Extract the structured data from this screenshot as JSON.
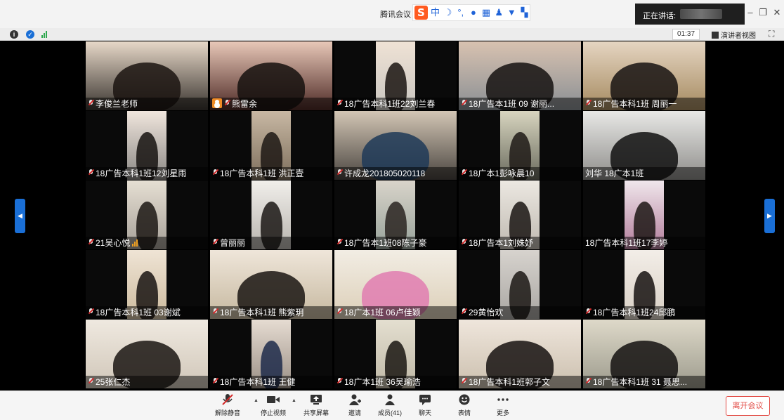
{
  "window": {
    "title": "腾讯会议",
    "speaking_label": "正在讲话:",
    "ime_logo": "S",
    "ime_mode": "中",
    "minimize_glyph": "–",
    "restore_glyph": "❐",
    "close_glyph": "✕"
  },
  "statusbar": {
    "timer": "01:37",
    "speaker_view_label": "演讲者视图",
    "fullscreen_glyph": "⛶"
  },
  "participants": [
    {
      "name": "李俊兰老师",
      "muted": true
    },
    {
      "name": "熊雷余",
      "muted": true,
      "host": true
    },
    {
      "name": "18广告本科1班22刘兰春",
      "muted": true
    },
    {
      "name": "18广告本1班 09 谢丽...",
      "muted": true
    },
    {
      "name": "18广告本科1班 周丽一",
      "muted": true
    },
    {
      "name": "18广告本科1班12刘星雨",
      "muted": true
    },
    {
      "name": "18广告本科1班 洪正壹",
      "muted": true
    },
    {
      "name": "许成龙201805020118",
      "muted": true
    },
    {
      "name": "18广本1彭咏晨10",
      "muted": true
    },
    {
      "name": "刘华 18广本1班",
      "muted": false
    },
    {
      "name": "21吴心悦",
      "muted": true,
      "speaking": true
    },
    {
      "name": "曾丽丽",
      "muted": true
    },
    {
      "name": "18广告本1班08陈子豪",
      "muted": true
    },
    {
      "name": "18广告本1刘姝妤",
      "muted": true
    },
    {
      "name": "18广告本科1班17李婷",
      "muted": false
    },
    {
      "name": "18广告本科1班 03谢斌",
      "muted": true
    },
    {
      "name": "18广告本科1班 熊紫玥",
      "muted": true
    },
    {
      "name": "18广本1班 06卢佳颖",
      "muted": true
    },
    {
      "name": "29黄怡欢",
      "muted": true
    },
    {
      "name": "18广告本科1班24邱鹏",
      "muted": true
    },
    {
      "name": "25张仁杰",
      "muted": true
    },
    {
      "name": "18广告本科1班 王健",
      "muted": true
    },
    {
      "name": "18广本1班 36吴瑜浩",
      "muted": true
    },
    {
      "name": "18广告本科1班郭子文",
      "muted": true
    },
    {
      "name": "18广告本科1班 31 聂思...",
      "muted": true
    }
  ],
  "toolbar": {
    "unmute": "解除静音",
    "stop_video": "停止视频",
    "share_screen": "共享屏幕",
    "invite": "邀请",
    "members": "成员(41)",
    "chat": "聊天",
    "reactions": "表情",
    "more": "更多",
    "leave": "离开会议"
  },
  "colors": {
    "accent": "#1a6fd6",
    "leave": "#e24b45",
    "mute_slash": "#d42b2b",
    "host_badge": "#f08a24"
  }
}
